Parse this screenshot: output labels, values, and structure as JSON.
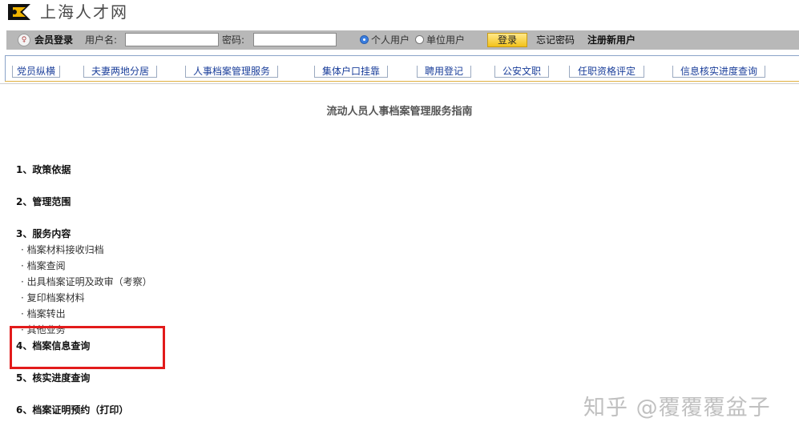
{
  "header": {
    "site_title": "上海人才网"
  },
  "login_bar": {
    "member_login": "会员登录",
    "username_label": "用户名:",
    "password_label": "密码:",
    "username_value": "",
    "password_value": "",
    "radio_personal": "个人用户",
    "radio_company": "单位用户",
    "selected_user_type": "个人用户",
    "login_button": "登录",
    "forgot_password": "忘记密码",
    "register": "注册新用户"
  },
  "nav": {
    "tabs": [
      "党员纵横",
      "夫妻两地分居",
      "人事档案管理服务",
      "集体户口挂靠",
      "聘用登记",
      "公安文职",
      "任职资格评定",
      "信息核实进度查询"
    ]
  },
  "content": {
    "title": "流动人员人事档案管理服务指南",
    "sections": [
      "1、政策依据",
      "2、管理范围",
      "3、服务内容",
      "4、档案信息查询",
      "5、核实进度查询",
      "6、档案证明预约（打印）"
    ],
    "service_items": [
      "· 档案材料接收归档",
      "· 档案查阅",
      "· 出具档案证明及政审（考察）",
      "· 复印档案材料",
      "· 档案转出",
      "· 其他业务"
    ]
  },
  "colors": {
    "highlight": "#e21b1b",
    "nav_text": "#1a3e9a",
    "login_bar_bg": "#b8b8b8",
    "login_button": "#f2c21a"
  },
  "watermark": "知乎 @覆覆覆盆子"
}
